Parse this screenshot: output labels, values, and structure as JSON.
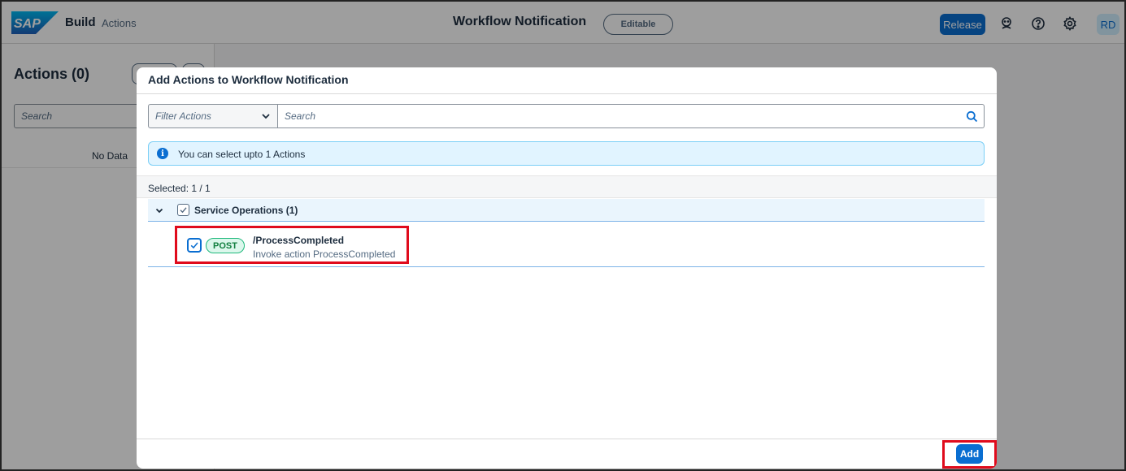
{
  "shell": {
    "logo": "SAP",
    "brand": "Build",
    "product": "Actions",
    "title": "Workflow Notification",
    "status_badge": "Editable",
    "release_label": "Release",
    "avatar_initials": "RD",
    "icons": [
      "feedback-icon",
      "help-icon",
      "settings-icon"
    ]
  },
  "left_panel": {
    "title": "Actions (0)",
    "search_placeholder": "Search",
    "empty_text": "No Data"
  },
  "dialog": {
    "title": "Add Actions to Workflow Notification",
    "filter_select": "Filter Actions",
    "search_placeholder": "Search",
    "info_message": "You can select upto 1 Actions",
    "selected_text": "Selected: 1 / 1",
    "group": {
      "label": "Service Operations (1)",
      "checked": true,
      "expanded": true
    },
    "items": [
      {
        "method": "POST",
        "path": "/ProcessCompleted",
        "description": "Invoke action ProcessCompleted",
        "checked": true
      }
    ],
    "add_label": "Add"
  },
  "colors": {
    "accent": "#0a6ed1",
    "highlight": "#e00b1c",
    "post_badge": "#107e3e"
  }
}
